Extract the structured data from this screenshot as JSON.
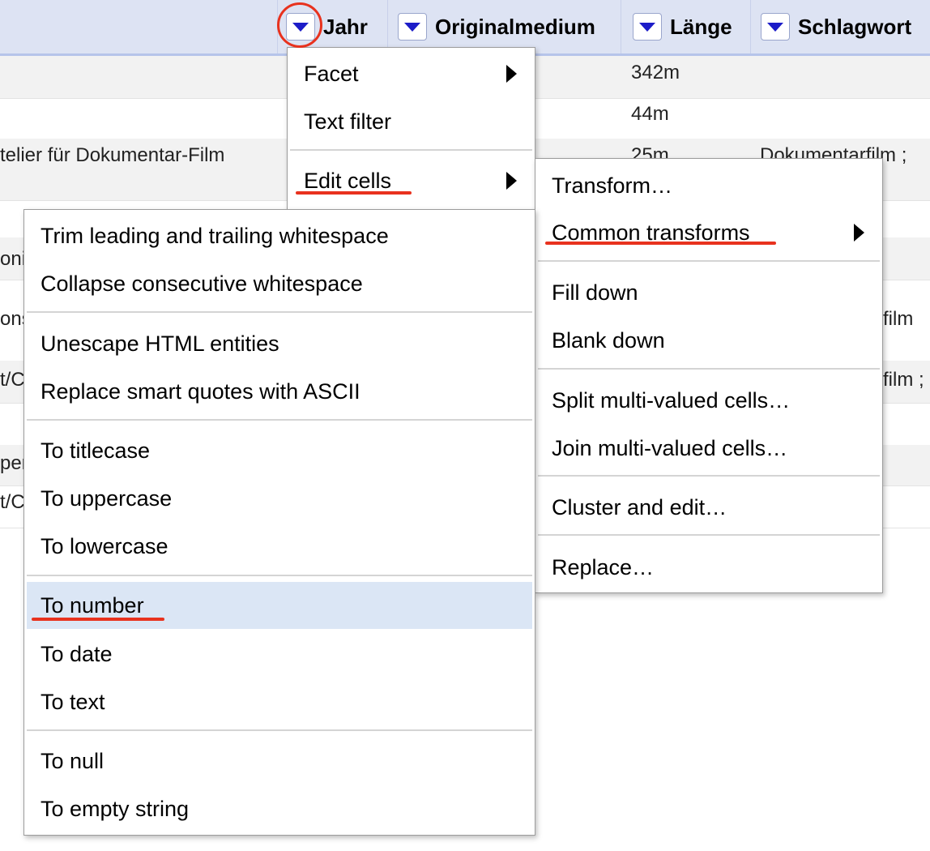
{
  "grid": {
    "columns": [
      {
        "name": "Jahr"
      },
      {
        "name": "Originalmedium"
      },
      {
        "name": "Länge"
      },
      {
        "name": "Schlagwort"
      }
    ],
    "cells": {
      "r1_laenge": "342m",
      "r2_laenge": "44m",
      "r3_left": "telier für Dokumentar-Film",
      "r3_laenge": "25m",
      "r3_schlagwort": "Dokumentarfilm ;",
      "f1": "oni",
      "f2": "ons",
      "f3": "t/C",
      "f4": "per",
      "f5": "t/C",
      "r_film1": "film",
      "r_film2": "film ;"
    }
  },
  "column_menu": {
    "items": [
      {
        "label": "Facet",
        "submenu": true
      },
      {
        "label": "Text filter"
      },
      {
        "label": "Edit cells",
        "submenu": true
      }
    ]
  },
  "edit_cells_menu": {
    "items": [
      {
        "label": "Transform…"
      },
      {
        "label": "Common transforms",
        "submenu": true
      },
      {
        "label": "Fill down"
      },
      {
        "label": "Blank down"
      },
      {
        "label": "Split multi-valued cells…"
      },
      {
        "label": "Join multi-valued cells…"
      },
      {
        "label": "Cluster and edit…"
      },
      {
        "label": "Replace…"
      }
    ]
  },
  "common_transforms_menu": {
    "items": [
      {
        "label": "Trim leading and trailing whitespace"
      },
      {
        "label": "Collapse consecutive whitespace"
      },
      {
        "label": "Unescape HTML entities"
      },
      {
        "label": "Replace smart quotes with ASCII"
      },
      {
        "label": "To titlecase"
      },
      {
        "label": "To uppercase"
      },
      {
        "label": "To lowercase"
      },
      {
        "label": "To number",
        "highlighted": true
      },
      {
        "label": "To date"
      },
      {
        "label": "To text"
      },
      {
        "label": "To null"
      },
      {
        "label": "To empty string"
      }
    ]
  },
  "colors": {
    "header_bg": "#dde3f3",
    "dropdown_triangle": "#1c1cc8",
    "annotation_red": "#e8321e",
    "menu_highlight": "#dbe6f5"
  }
}
